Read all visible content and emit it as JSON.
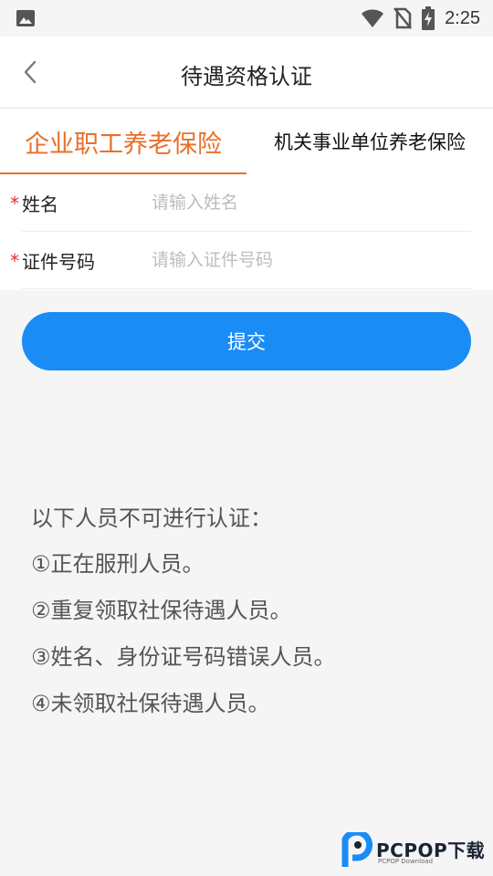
{
  "status_bar": {
    "time": "2:25",
    "icons": [
      "image-icon",
      "wifi-icon",
      "no-sim-icon",
      "battery-charging-icon"
    ]
  },
  "header": {
    "title": "待遇资格认证",
    "back_icon": "chevron-left-icon"
  },
  "tabs": [
    {
      "label": "企业职工养老保险",
      "active": true
    },
    {
      "label": "机关事业单位养老保险",
      "active": false
    }
  ],
  "form": {
    "name": {
      "label": "姓名",
      "required_mark": "*",
      "placeholder": "请输入姓名",
      "value": ""
    },
    "id_number": {
      "label": "证件号码",
      "required_mark": "*",
      "placeholder": "请输入证件号码",
      "value": ""
    }
  },
  "submit": {
    "label": "提交"
  },
  "notice": {
    "title": "以下人员不可进行认证：",
    "items": [
      "①正在服刑人员。",
      "②重复领取社保待遇人员。",
      "③姓名、身份证号码错误人员。",
      "④未领取社保待遇人员。"
    ]
  },
  "watermark": {
    "text": "PCPOP下载",
    "sub": "PCPOP Download"
  },
  "colors": {
    "accent": "#e8702a",
    "primary": "#1a8cf5",
    "required": "#e0312f",
    "background": "#f5f5f5"
  }
}
